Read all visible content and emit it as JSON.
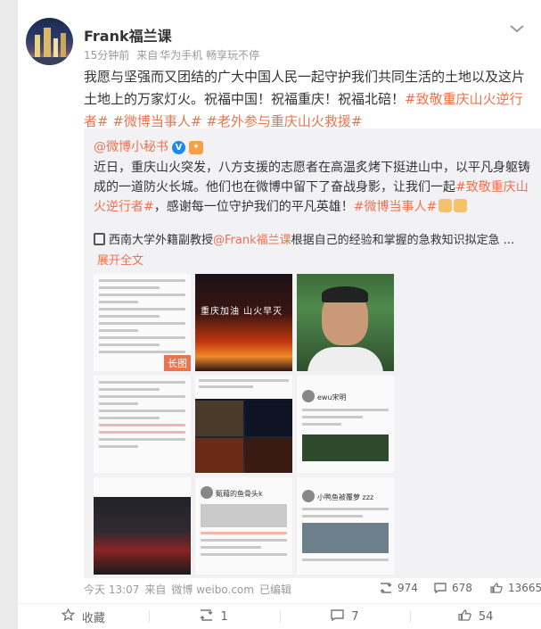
{
  "post": {
    "author": "Frank福兰课",
    "time": "15分钟前",
    "source_prefix": "来自",
    "source": "华为手机 畅享玩不停",
    "text_plain_1": "我愿与坚强而又团结的广大中国人民一起守护我们共同生活的土地以及这片土地上的万家灯火。祝福中国！祝福重庆！祝福北碚！",
    "tag_1": "#致敬重庆山火逆行者#",
    "tag_2": "#微博当事人#",
    "tag_3": "#老外参与重庆山火救援#"
  },
  "repost": {
    "author": "@微博小秘书",
    "verified_badge": "V",
    "level_badge": "✦",
    "text_1": "近日，重庆山火突发，八方支援的志愿者在高温炙烤下挺进山中，以平凡身躯铸成的一道防火长城。他们也在微博中留下了奋战身影，让我们一起",
    "tag_1": "#致敬重庆山火逆行者#",
    "text_2": "，感谢每一位守护我们的平凡英雄！",
    "tag_2": "#微博当事人#",
    "note_prefix": "西南大学外籍副教授",
    "note_at": "@Frank福兰课",
    "note_text": " 根据自己的经验和掌握的急救知识拟定急 ...",
    "expand": "展开全文",
    "images": {
      "long_image_label": "长图",
      "fire_caption": "重庆加油  山火早灭",
      "user_1": "ewu宋明",
      "user_2": "甄藉的鱼骨头k",
      "user_3": "小鸭鱼被覆萝 zzz"
    }
  },
  "footer": {
    "date": "今天 13:07",
    "source_prefix": "来自",
    "source": "微博 weibo.com",
    "edited": "已编辑",
    "reposts": "974",
    "comments": "678",
    "likes": "13665"
  },
  "actions": {
    "favorite": "收藏",
    "repost": "1",
    "comment": "7",
    "like": "54"
  },
  "colors": {
    "accent": "#eb7350",
    "verified": "#1a8bf0",
    "repost_bg": "#f2f2f5"
  }
}
